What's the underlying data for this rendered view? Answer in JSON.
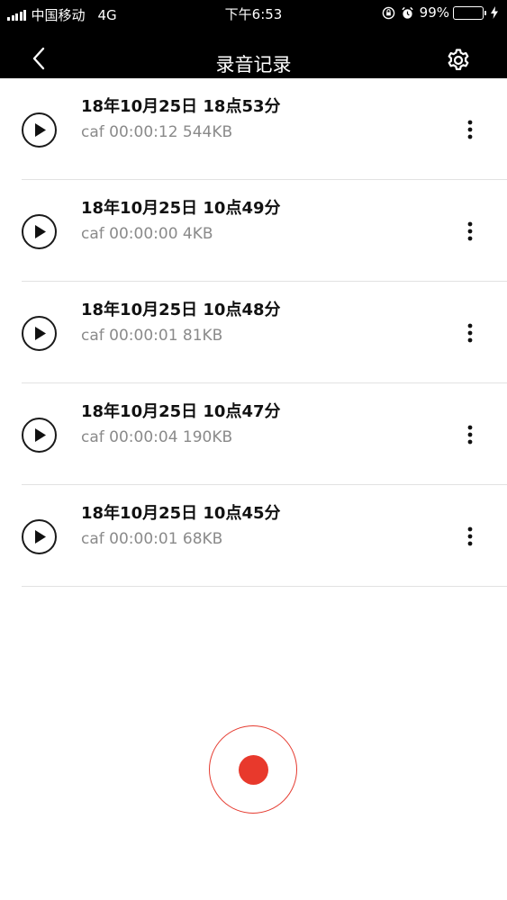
{
  "status_bar": {
    "carrier": "中国移动",
    "network": "4G",
    "time": "下午6:53",
    "battery_percent": "99%",
    "icons": [
      "signal-icon",
      "orientation-lock-icon",
      "alarm-icon",
      "battery-icon",
      "charging-icon"
    ]
  },
  "nav": {
    "title": "录音记录",
    "back_icon": "chevron-left-icon",
    "settings_icon": "gear-icon"
  },
  "recordings": [
    {
      "title": "18年10月25日 18点53分",
      "meta": "caf 00:00:12 544KB"
    },
    {
      "title": "18年10月25日 10点49分",
      "meta": "caf 00:00:00 4KB"
    },
    {
      "title": "18年10月25日 10点48分",
      "meta": "caf 00:00:01 81KB"
    },
    {
      "title": "18年10月25日 10点47分",
      "meta": "caf 00:00:04 190KB"
    },
    {
      "title": "18年10月25日 10点45分",
      "meta": "caf 00:00:01 68KB"
    }
  ],
  "colors": {
    "header_bg": "#000000",
    "record_accent": "#e8392c",
    "battery_green": "#4cd964",
    "meta_text": "#8a8a8a"
  }
}
